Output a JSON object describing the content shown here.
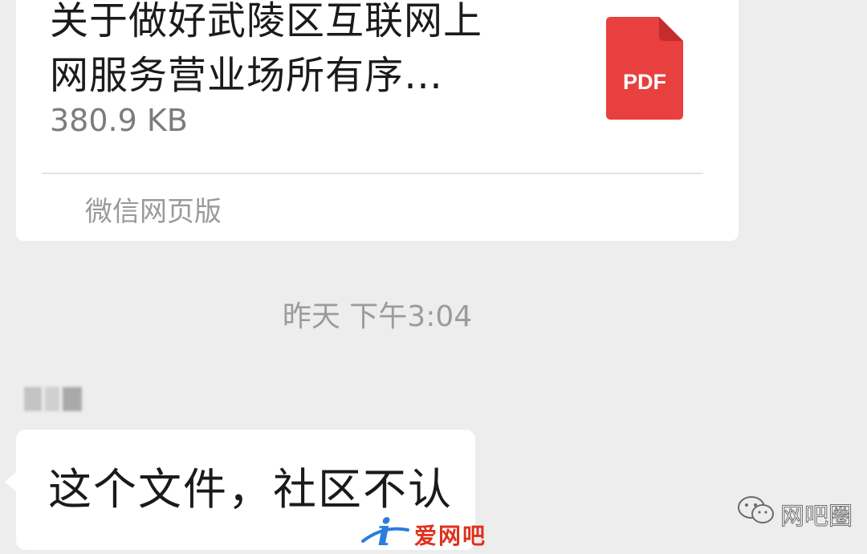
{
  "file_message": {
    "title_line1": "关于做好武陵区互联网上",
    "title_line2": "网服务营业场所有序…",
    "size": "380.9 KB",
    "file_type_label": "PDF",
    "source": "微信网页版",
    "file_icon": "pdf-icon",
    "icon_color": "#e8403f"
  },
  "timestamp": "昨天 下午3:04",
  "message": {
    "sender": "",
    "text": "这个文件，社区不认"
  },
  "watermark": {
    "brand_mark": "i",
    "brand_name": "爱网吧",
    "channel": "网吧圈",
    "channel_icon": "wechat-icon"
  },
  "colors": {
    "background": "#ededed",
    "bubble": "#ffffff",
    "pdf_red": "#e8403f"
  }
}
